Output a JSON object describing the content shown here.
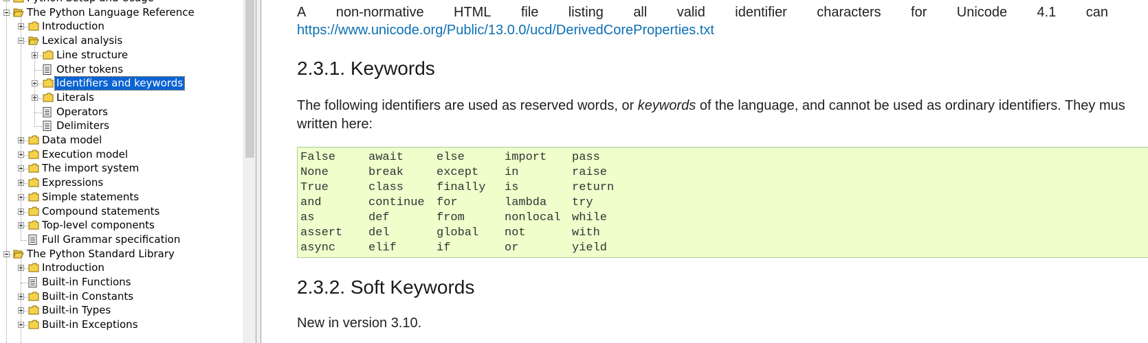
{
  "tree": {
    "items": [
      {
        "label": "Python Setup and Usage",
        "icon": "folder-closed-icon",
        "toggle": "plus",
        "level": 0
      },
      {
        "label": "The Python Language Reference",
        "icon": "folder-open-icon",
        "toggle": "minus",
        "level": 0
      },
      {
        "label": "Introduction",
        "icon": "folder-closed-icon",
        "toggle": "plus",
        "level": 1
      },
      {
        "label": "Lexical analysis",
        "icon": "folder-open-icon",
        "toggle": "minus",
        "level": 1
      },
      {
        "label": "Line structure",
        "icon": "folder-closed-icon",
        "toggle": "plus",
        "level": 2
      },
      {
        "label": "Other tokens",
        "icon": "page-icon",
        "toggle": "none",
        "level": 2
      },
      {
        "label": "Identifiers and keywords",
        "icon": "folder-closed-icon",
        "toggle": "plus",
        "level": 2,
        "selected": true
      },
      {
        "label": "Literals",
        "icon": "folder-closed-icon",
        "toggle": "plus",
        "level": 2
      },
      {
        "label": "Operators",
        "icon": "page-icon",
        "toggle": "none",
        "level": 2
      },
      {
        "label": "Delimiters",
        "icon": "page-icon",
        "toggle": "none",
        "level": 2
      },
      {
        "label": "Data model",
        "icon": "folder-closed-icon",
        "toggle": "plus",
        "level": 1
      },
      {
        "label": "Execution model",
        "icon": "folder-closed-icon",
        "toggle": "plus",
        "level": 1
      },
      {
        "label": "The import system",
        "icon": "folder-closed-icon",
        "toggle": "plus",
        "level": 1
      },
      {
        "label": "Expressions",
        "icon": "folder-closed-icon",
        "toggle": "plus",
        "level": 1
      },
      {
        "label": "Simple statements",
        "icon": "folder-closed-icon",
        "toggle": "plus",
        "level": 1
      },
      {
        "label": "Compound statements",
        "icon": "folder-closed-icon",
        "toggle": "plus",
        "level": 1
      },
      {
        "label": "Top-level components",
        "icon": "folder-closed-icon",
        "toggle": "plus",
        "level": 1
      },
      {
        "label": "Full Grammar specification",
        "icon": "page-icon",
        "toggle": "none",
        "level": 1
      },
      {
        "label": "The Python Standard Library",
        "icon": "folder-open-icon",
        "toggle": "minus",
        "level": 0
      },
      {
        "label": "Introduction",
        "icon": "folder-closed-icon",
        "toggle": "plus",
        "level": 1
      },
      {
        "label": "Built-in Functions",
        "icon": "page-icon",
        "toggle": "none",
        "level": 1
      },
      {
        "label": "Built-in Constants",
        "icon": "folder-closed-icon",
        "toggle": "plus",
        "level": 1
      },
      {
        "label": "Built-in Types",
        "icon": "folder-closed-icon",
        "toggle": "plus",
        "level": 1
      },
      {
        "label": "Built-in Exceptions",
        "icon": "folder-closed-icon",
        "toggle": "plus",
        "level": 1
      }
    ]
  },
  "content": {
    "intro_words": [
      "A",
      "non-normative",
      "HTML",
      "file",
      "listing",
      "all",
      "valid",
      "identifier",
      "characters",
      "for",
      "Unicode",
      "4.1",
      "can"
    ],
    "link": "https://www.unicode.org/Public/13.0.0/ucd/DerivedCoreProperties.txt",
    "heading_keywords": "2.3.1. Keywords",
    "kw_para_before": "The following identifiers are used as reserved words, or ",
    "kw_para_em": "keywords",
    "kw_para_after": " of the language, and cannot be used as ordinary identifiers. They mus",
    "kw_para_line2": "written here:",
    "keyword_columns": [
      [
        "False",
        "None",
        "True",
        "and",
        "as",
        "assert",
        "async"
      ],
      [
        "await",
        "break",
        "class",
        "continue",
        "def",
        "del",
        "elif"
      ],
      [
        "else",
        "except",
        "finally",
        "for",
        "from",
        "global",
        "if"
      ],
      [
        "import",
        "in",
        "is",
        "lambda",
        "nonlocal",
        "not",
        "or"
      ],
      [
        "pass",
        "raise",
        "return",
        "try",
        "while",
        "with",
        "yield"
      ]
    ],
    "heading_soft": "2.3.2. Soft Keywords",
    "soft_para": "New in version 3.10."
  },
  "colors": {
    "selection": "#0a63d3",
    "link": "#0b6fb4",
    "code_background": "#eeffcc",
    "code_border": "#aacc99",
    "folder": "#f5d24a"
  }
}
